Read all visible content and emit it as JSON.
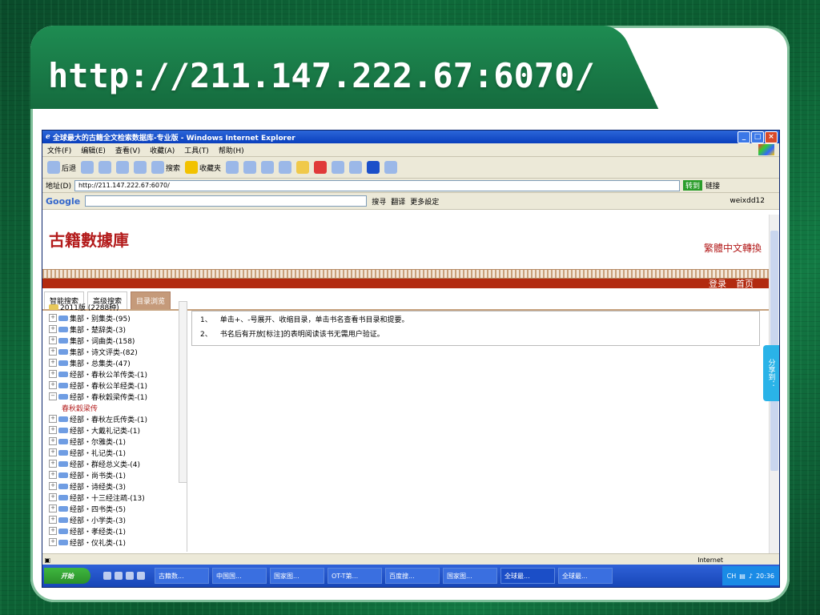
{
  "slide": {
    "title": "http://211.147.222.67:6070/"
  },
  "window": {
    "title": "全球最大的古籍全文检索数据库-专业版 - Windows Internet Explorer",
    "min_label": "_",
    "max_label": "□",
    "close_label": "×"
  },
  "menu": [
    "文件(F)",
    "编辑(E)",
    "查看(V)",
    "收藏(A)",
    "工具(T)",
    "帮助(H)"
  ],
  "toolbar": {
    "back": "后退",
    "search": "搜索",
    "favorites": "收藏夹"
  },
  "address": {
    "label": "地址(D)",
    "url": "http://211.147.222.67:6070/",
    "go": "转到",
    "links": "链接"
  },
  "google": {
    "logo": "Google",
    "search": "搜寻",
    "translate": "翻译",
    "more": "更多設定",
    "user": "weixdd12"
  },
  "site": {
    "logo": "古籍數據庫",
    "convert": "繁體中文轉換",
    "login": "登录",
    "home": "首页"
  },
  "tabs": [
    "智能搜索",
    "高级搜索",
    "目录浏览"
  ],
  "tree": [
    {
      "label": "2011版 (2288种)",
      "type": "root"
    },
    {
      "label": "集部・别集类-(95)",
      "type": "node",
      "exp": "+"
    },
    {
      "label": "集部・楚辞类-(3)",
      "type": "node",
      "exp": "+"
    },
    {
      "label": "集部・词曲类-(158)",
      "type": "node",
      "exp": "+"
    },
    {
      "label": "集部・诗文评类-(82)",
      "type": "node",
      "exp": "+"
    },
    {
      "label": "集部・总集类-(47)",
      "type": "node",
      "exp": "+"
    },
    {
      "label": "经部・春秋公羊传类-(1)",
      "type": "node",
      "exp": "+"
    },
    {
      "label": "经部・春秋公羊经类-(1)",
      "type": "node",
      "exp": "+"
    },
    {
      "label": "经部・春秋穀梁传类-(1)",
      "type": "node",
      "exp": "−"
    },
    {
      "label": "春秋穀梁传",
      "type": "sub"
    },
    {
      "label": "经部・春秋左氏传类-(1)",
      "type": "node",
      "exp": "+"
    },
    {
      "label": "经部・大戴礼记类-(1)",
      "type": "node",
      "exp": "+"
    },
    {
      "label": "经部・尔雅类-(1)",
      "type": "node",
      "exp": "+"
    },
    {
      "label": "经部・礼记类-(1)",
      "type": "node",
      "exp": "+"
    },
    {
      "label": "经部・群经总义类-(4)",
      "type": "node",
      "exp": "+"
    },
    {
      "label": "经部・尚书类-(1)",
      "type": "node",
      "exp": "+"
    },
    {
      "label": "经部・诗经类-(3)",
      "type": "node",
      "exp": "+"
    },
    {
      "label": "经部・十三经注疏-(13)",
      "type": "node",
      "exp": "+"
    },
    {
      "label": "经部・四书类-(5)",
      "type": "node",
      "exp": "+"
    },
    {
      "label": "经部・小学类-(3)",
      "type": "node",
      "exp": "+"
    },
    {
      "label": "经部・孝经类-(1)",
      "type": "node",
      "exp": "+"
    },
    {
      "label": "经部・仪礼类-(1)",
      "type": "node",
      "exp": "+"
    }
  ],
  "info": [
    {
      "num": "1、",
      "text": "单击+、-号展开、收缩目录，单击书名查看书目录和提要。"
    },
    {
      "num": "2、",
      "text": "书名后有开放[标注]的表明阅读该书无需用户验证。"
    }
  ],
  "share": "分享到：",
  "status": {
    "zone": "Internet"
  },
  "taskbar": {
    "start": "开始",
    "tasks": [
      "古籍数...",
      "中国国...",
      "国家图...",
      "OT-T第...",
      "百度搜...",
      "国家图...",
      "全球最...",
      "全球最..."
    ],
    "tray": {
      "lang": "CH",
      "time": "20:36"
    }
  }
}
